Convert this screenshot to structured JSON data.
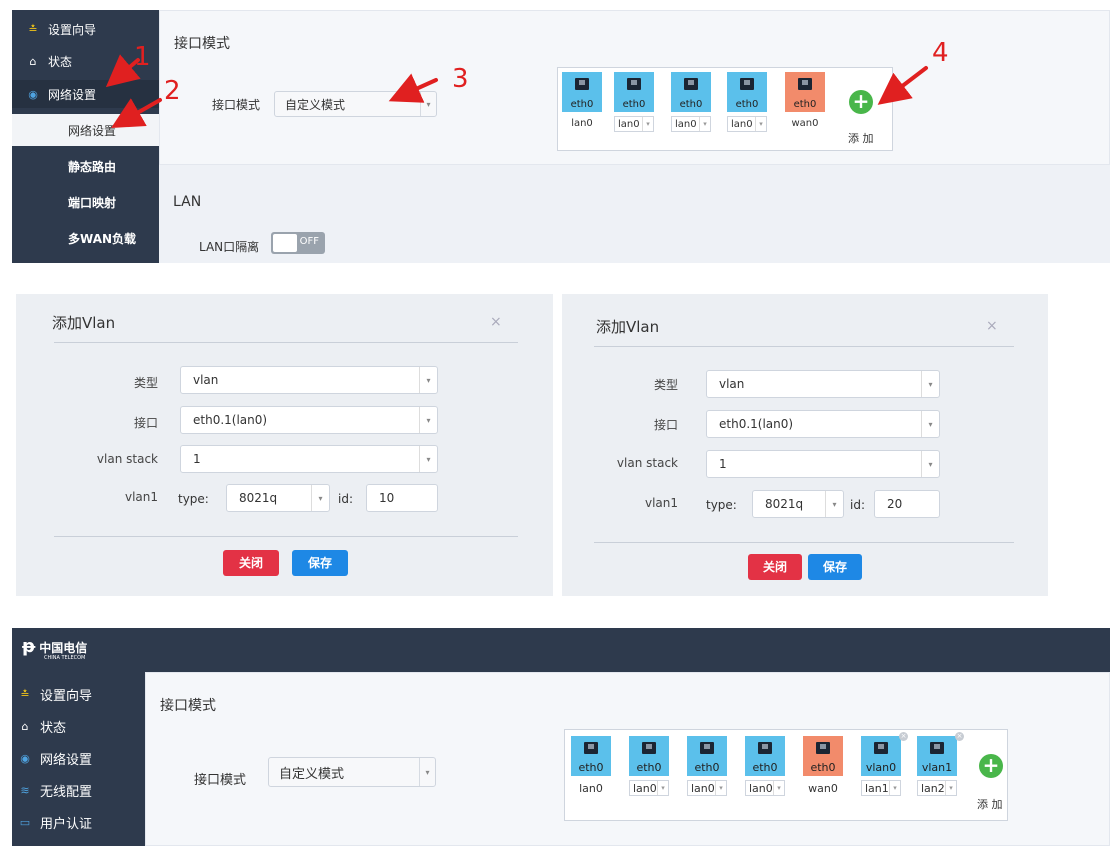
{
  "panel1": {
    "sidebar": [
      {
        "icon": "wizard-icon",
        "label": "设置向导"
      },
      {
        "icon": "home-icon",
        "label": "状态"
      },
      {
        "icon": "globe-icon",
        "label": "网络设置"
      },
      {
        "label": "网络设置"
      },
      {
        "label": "静态路由"
      },
      {
        "label": "端口映射"
      },
      {
        "label": "多WAN负载"
      }
    ],
    "section_title": "接口模式",
    "mode_label": "接口模式",
    "mode_value": "自定义模式",
    "ports": [
      {
        "name": "eth0",
        "assign": "lan0",
        "type": "lan",
        "dropdown": false
      },
      {
        "name": "eth0",
        "assign": "lan0",
        "type": "lan",
        "dropdown": true
      },
      {
        "name": "eth0",
        "assign": "lan0",
        "type": "lan",
        "dropdown": true
      },
      {
        "name": "eth0",
        "assign": "lan0",
        "type": "lan",
        "dropdown": true
      },
      {
        "name": "eth0",
        "assign": "wan0",
        "type": "wan",
        "dropdown": false
      }
    ],
    "add_label": "添 加",
    "lan_title": "LAN",
    "lan_isolation_label": "LAN口隔离",
    "toggle_text": "OFF",
    "annotations": [
      "1",
      "2",
      "3",
      "4"
    ]
  },
  "dialog_a": {
    "title": "添加Vlan",
    "close": "×",
    "type_label": "类型",
    "type_value": "vlan",
    "iface_label": "接口",
    "iface_value": "eth0.1(lan0)",
    "stack_label": "vlan stack",
    "stack_value": "1",
    "vlan1_label": "vlan1",
    "type_word": "type:",
    "proto_value": "8021q",
    "id_word": "id:",
    "id_value": "10",
    "close_btn": "关闭",
    "save_btn": "保存"
  },
  "dialog_b": {
    "title": "添加Vlan",
    "close": "×",
    "type_label": "类型",
    "type_value": "vlan",
    "iface_label": "接口",
    "iface_value": "eth0.1(lan0)",
    "stack_label": "vlan stack",
    "stack_value": "1",
    "vlan1_label": "vlan1",
    "type_word": "type:",
    "proto_value": "8021q",
    "id_word": "id:",
    "id_value": "20",
    "close_btn": "关闭",
    "save_btn": "保存"
  },
  "panel3": {
    "logo_text": "中国电信",
    "logo_sub": "CHINA TELECOM",
    "sidebar": [
      {
        "icon": "wizard-icon",
        "label": "设置向导"
      },
      {
        "icon": "home-icon",
        "label": "状态"
      },
      {
        "icon": "globe-icon",
        "label": "网络设置"
      },
      {
        "icon": "wifi-icon",
        "label": "无线配置"
      },
      {
        "icon": "card-icon",
        "label": "用户认证"
      }
    ],
    "section_title": "接口模式",
    "mode_label": "接口模式",
    "mode_value": "自定义模式",
    "ports": [
      {
        "name": "eth0",
        "assign": "lan0",
        "type": "lan"
      },
      {
        "name": "eth0",
        "assign": "lan0",
        "type": "lan"
      },
      {
        "name": "eth0",
        "assign": "lan0",
        "type": "lan"
      },
      {
        "name": "eth0",
        "assign": "lan0",
        "type": "lan"
      },
      {
        "name": "eth0",
        "assign": "wan0",
        "type": "wan"
      },
      {
        "name": "vlan0",
        "assign": "lan1",
        "type": "lan"
      },
      {
        "name": "vlan1",
        "assign": "lan2",
        "type": "lan"
      }
    ],
    "add_label": "添 加"
  },
  "colors": {
    "sidebar": "#2e3a4d",
    "lan_port": "#5bc0eb",
    "wan_port": "#f28b6b",
    "add_green": "#49b64a",
    "btn_red": "#e33245",
    "btn_blue": "#1e88e5",
    "annotation_red": "#e02020"
  }
}
